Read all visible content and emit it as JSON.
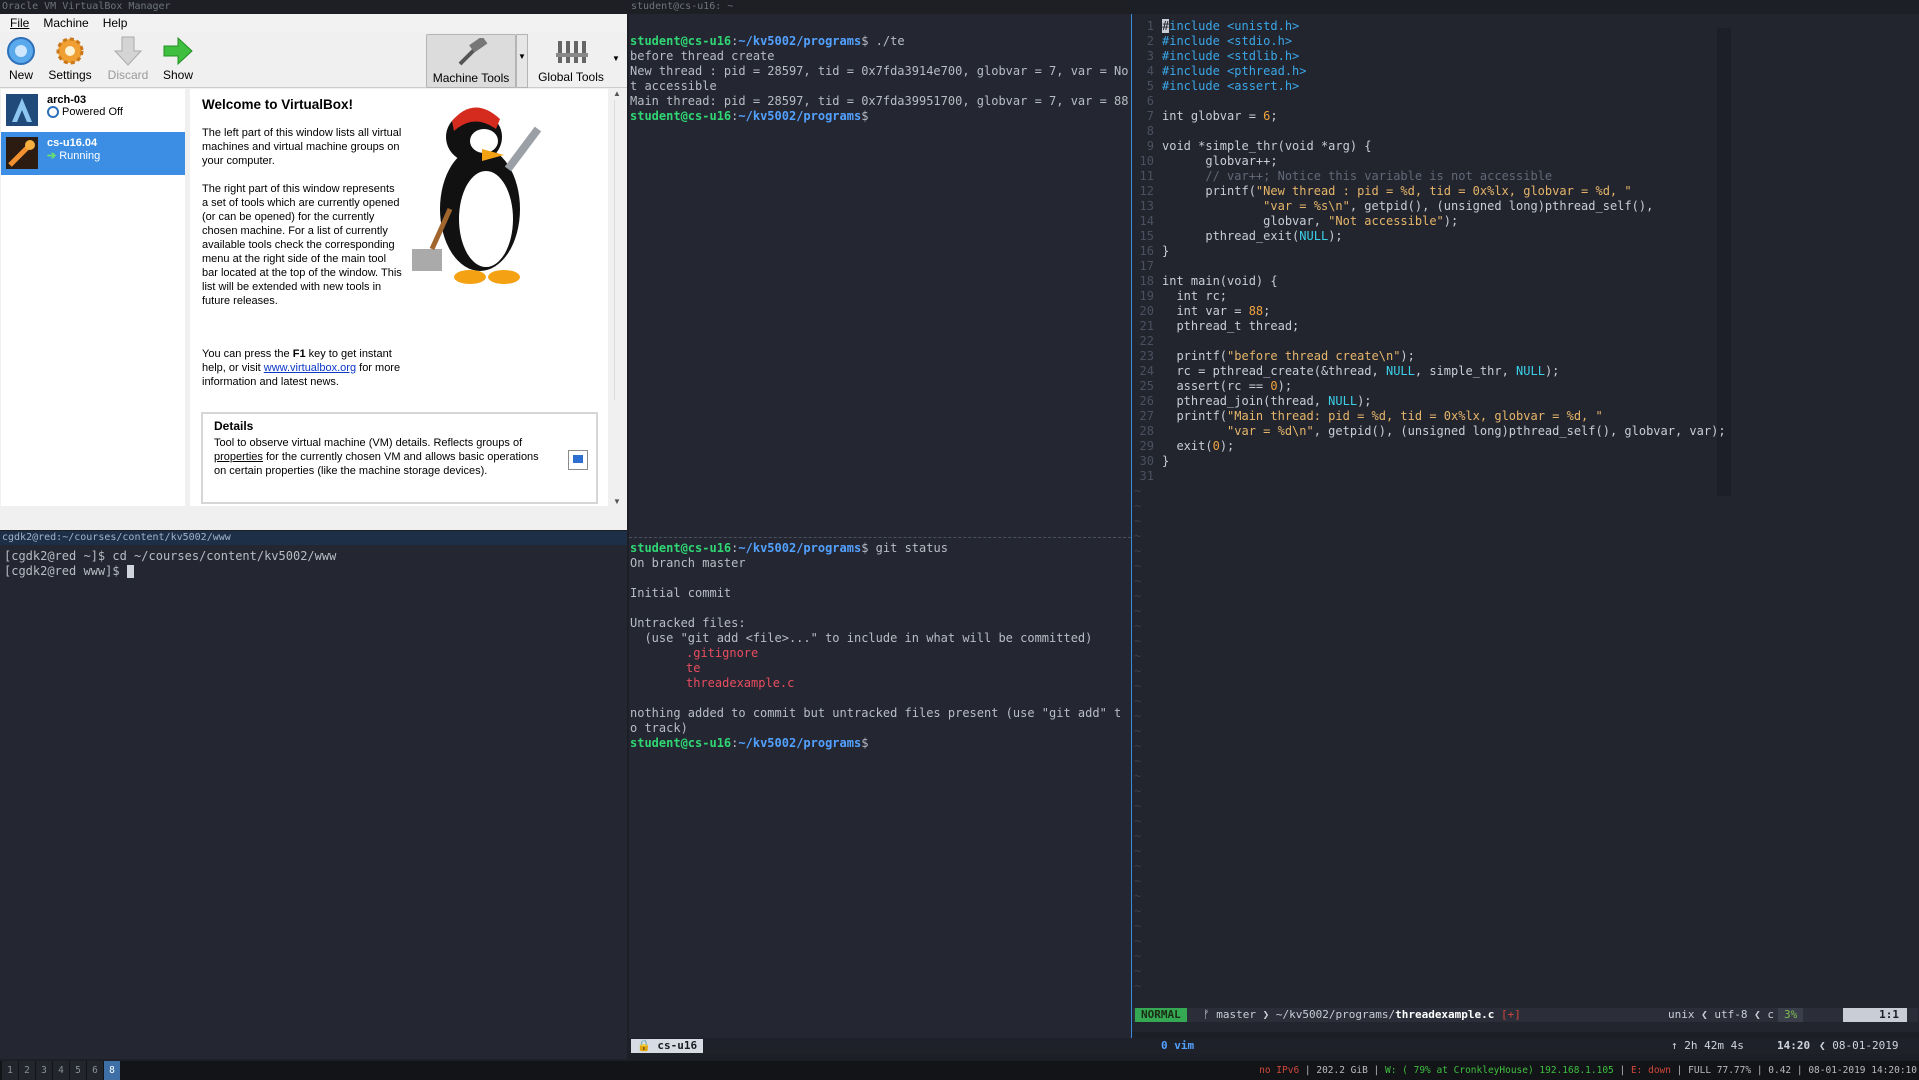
{
  "vbox": {
    "title": "Oracle VM VirtualBox Manager",
    "menu": [
      "File",
      "Machine",
      "Help"
    ],
    "toolbar": {
      "new": "New",
      "settings": "Settings",
      "discard": "Discard",
      "show": "Show",
      "machine_tools": "Machine Tools",
      "global_tools": "Global Tools"
    },
    "vms": [
      {
        "name": "arch-03",
        "state": "Powered Off"
      },
      {
        "name": "cs-u16.04",
        "state": "Running"
      }
    ],
    "welcome": {
      "title": "Welcome to VirtualBox!",
      "p1": "The left part of this window lists all virtual machines and virtual machine groups on your computer.",
      "p2": "The right part of this window represents a set of tools which are currently opened (or can be opened) for the currently chosen machine. For a list of currently available tools check the corresponding menu at the right side of the main tool bar located at the top of the window. This list will be extended with new tools in future releases.",
      "p3a": "You can press the ",
      "p3key": "F1",
      "p3b": " key to get instant help, or visit ",
      "p3link": "www.virtualbox.org",
      "p3c": " for more information and latest news."
    },
    "details": {
      "title": "Details",
      "text_a": "Tool to observe virtual machine (VM) details. Reflects groups of ",
      "link": "properties",
      "text_b": " for the currently chosen VM and allows basic operations on certain properties (like the machine storage devices)."
    }
  },
  "left_term": {
    "title": "cgdk2@red:~/courses/content/kv5002/www",
    "lines": [
      "[cgdk2@red ~]$ cd ~/courses/content/kv5002/www",
      "[cgdk2@red www]$ "
    ]
  },
  "mid_term": {
    "title": "student@cs-u16: ~",
    "prompt_user": "student@cs-u16",
    "prompt_path": "~/kv5002/programs",
    "cmd1": " ./te",
    "out1": "before thread create\nNew thread : pid = 28597, tid = 0x7fda3914e700, globvar = 7, var = Not accessible\nMain thread: pid = 28597, tid = 0x7fda39951700, globvar = 7, var = 88",
    "cmd2": " git status",
    "out2": "On branch master\n\nInitial commit\n\nUntracked files:\n  (use \"git add <file>...\" to include in what will be committed)\n",
    "untracked": [
      ".gitignore",
      "te",
      "threadexample.c"
    ],
    "out3": "nothing added to commit but untracked files present (use \"git add\" to track)"
  },
  "vim": {
    "mode": "NORMAL",
    "branch": "master",
    "path_dir": "~/kv5002/programs/",
    "path_file": "threadexample.c",
    "flag": "[+]",
    "encoding": "unix",
    "charset": "utf-8",
    "filetype": "c",
    "percent": "3%",
    "position": "1:1"
  },
  "tmux": {
    "session": "cs-u16",
    "window": "0 vim",
    "uptime": "2h 42m 4s",
    "time": "14:20",
    "date": "08-01-2019"
  },
  "bar": {
    "workspaces": [
      "1",
      "2",
      "3",
      "4",
      "5",
      "6",
      "8"
    ],
    "active_ws": "8",
    "ipv6": "no IPv6",
    "disk": "202.2 GiB",
    "wifi": "W: ( 79% at CronkleyHouse) 192.168.1.105",
    "eth": "E: down",
    "battery": "FULL 77.77%",
    "load": "0.42",
    "datetime": "08-01-2019 14:20:10"
  },
  "colors": {
    "accent": "#3b8ee3",
    "prompt": "#2fd673",
    "path": "#53a1ff",
    "vim_mode": "#34a853"
  }
}
